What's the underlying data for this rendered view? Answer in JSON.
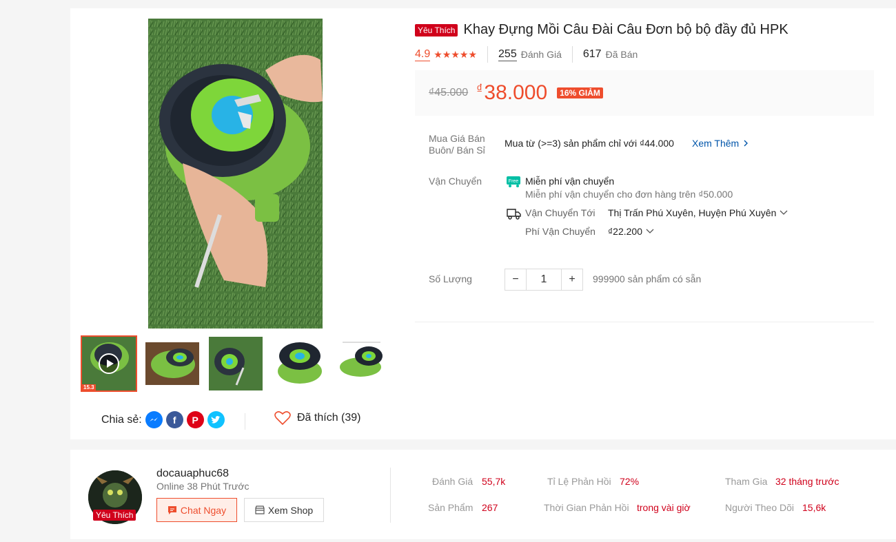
{
  "product": {
    "badge": "Yêu Thích",
    "title": "Khay Đựng Mồi Câu Đài Câu Đơn bộ bộ đầy đủ HPK",
    "rating_value": "4.9",
    "stars": "★★★★★",
    "review_count": "255",
    "review_label": "Đánh Giá",
    "sold_count": "617",
    "sold_label": "Đã Bán",
    "old_price": "₫45.000",
    "currency": "₫",
    "price": "38.000",
    "discount": "16% GIẢM"
  },
  "wholesale": {
    "label": "Mua Giá Bán Buôn/ Bán Sỉ",
    "text": "Mua từ (>=3) sản phẩm chỉ với ₫44.000",
    "more": "Xem Thêm"
  },
  "shipping": {
    "label": "Vận Chuyển",
    "free_icon_text": "Free",
    "free_title": "Miễn phí vận chuyển",
    "free_desc": "Miễn phí vận chuyển cho đơn hàng trên ₫50.000",
    "to_label": "Vận Chuyển Tới",
    "to_value": "Thị Trấn Phú Xuyên, Huyện Phú Xuyên",
    "fee_label": "Phí Vận Chuyển",
    "fee_value": "₫22.200"
  },
  "quantity": {
    "label": "Số Lượng",
    "minus": "−",
    "value": "1",
    "plus": "+",
    "stock": "999900 sản phẩm có sẵn"
  },
  "gallery": {
    "thumb_badge": "15.3"
  },
  "share": {
    "label": "Chia sẻ:",
    "liked": "Đã thích (39)"
  },
  "shop": {
    "badge": "Yêu Thích",
    "name": "docauaphuc68",
    "online": "Online 38 Phút Trước",
    "chat": "Chat Ngay",
    "view": "Xem Shop",
    "stats": [
      {
        "label": "Đánh Giá",
        "value": "55,7k"
      },
      {
        "label": "Tỉ Lệ Phản Hồi",
        "value": "72%"
      },
      {
        "label": "Tham Gia",
        "value": "32 tháng trước"
      },
      {
        "label": "Sản Phẩm",
        "value": "267"
      },
      {
        "label": "Thời Gian Phản Hồi",
        "value": "trong vài giờ"
      },
      {
        "label": "Người Theo Dõi",
        "value": "15,6k"
      }
    ]
  },
  "colors": {
    "accent": "#ee4d2d",
    "brand_red": "#d0011b",
    "link": "#0055aa"
  }
}
